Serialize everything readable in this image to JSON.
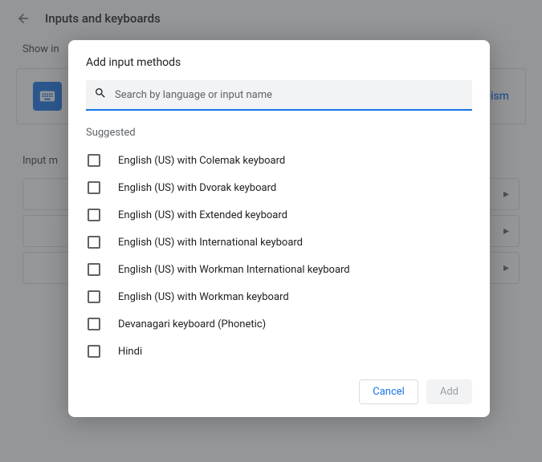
{
  "header": {
    "title": "Inputs and keyboards"
  },
  "background": {
    "show_label": "Show in",
    "dismiss": "Dism",
    "input_section": "Input m"
  },
  "dialog": {
    "title": "Add input methods",
    "search_placeholder": "Search by language or input name",
    "suggested_label": "Suggested",
    "cancel": "Cancel",
    "add": "Add",
    "options": [
      "English (US) with Colemak keyboard",
      "English (US) with Dvorak keyboard",
      "English (US) with Extended keyboard",
      "English (US) with International keyboard",
      "English (US) with Workman International keyboard",
      "English (US) with Workman keyboard",
      "Devanagari keyboard (Phonetic)",
      "Hindi"
    ]
  }
}
